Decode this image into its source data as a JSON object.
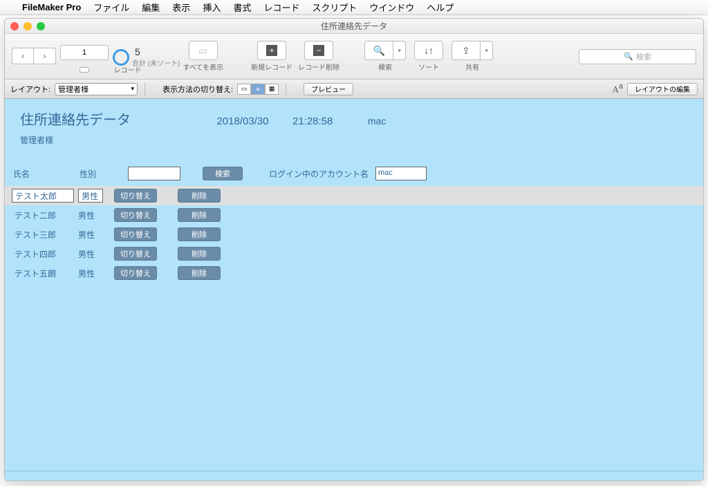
{
  "menubar": {
    "app": "FileMaker Pro",
    "items": [
      "ファイル",
      "編集",
      "表示",
      "挿入",
      "書式",
      "レコード",
      "スクリプト",
      "ウインドウ",
      "ヘルプ"
    ]
  },
  "window": {
    "title": "住所連絡先データ"
  },
  "toolbar": {
    "record_pos": "1",
    "record_total": "5",
    "record_sub": "合計 (未ソート)",
    "record_label": "レコード",
    "show_all": "すべてを表示",
    "new_record": "新規レコード",
    "delete_record": "レコード削除",
    "search_label": "検索",
    "sort_label": "ソート",
    "share_label": "共有",
    "search_placeholder": "検索"
  },
  "layoutbar": {
    "layout_label": "レイアウト:",
    "layout_value": "管理者様",
    "view_label": "表示方法の切り替え:",
    "preview": "プレビュー",
    "edit_layout": "レイアウトの編集"
  },
  "header": {
    "title": "住所連絡先データ",
    "date": "2018/03/30",
    "time": "21:28:58",
    "user": "mac",
    "subtitle": "管理者様"
  },
  "search": {
    "name_label": "氏名",
    "sex_label": "性別",
    "search_btn": "検索",
    "login_label": "ログイン中のアカウント名",
    "login_value": "mac"
  },
  "columns": {
    "switch": "切り替え",
    "delete": "削除"
  },
  "rows": [
    {
      "name": "テスト太郎",
      "sex": "男性",
      "selected": true
    },
    {
      "name": "テスト二郎",
      "sex": "男性",
      "selected": false
    },
    {
      "name": "テスト三郎",
      "sex": "男性",
      "selected": false
    },
    {
      "name": "テスト四郎",
      "sex": "男性",
      "selected": false
    },
    {
      "name": "テスト五朗",
      "sex": "男性",
      "selected": false
    }
  ]
}
